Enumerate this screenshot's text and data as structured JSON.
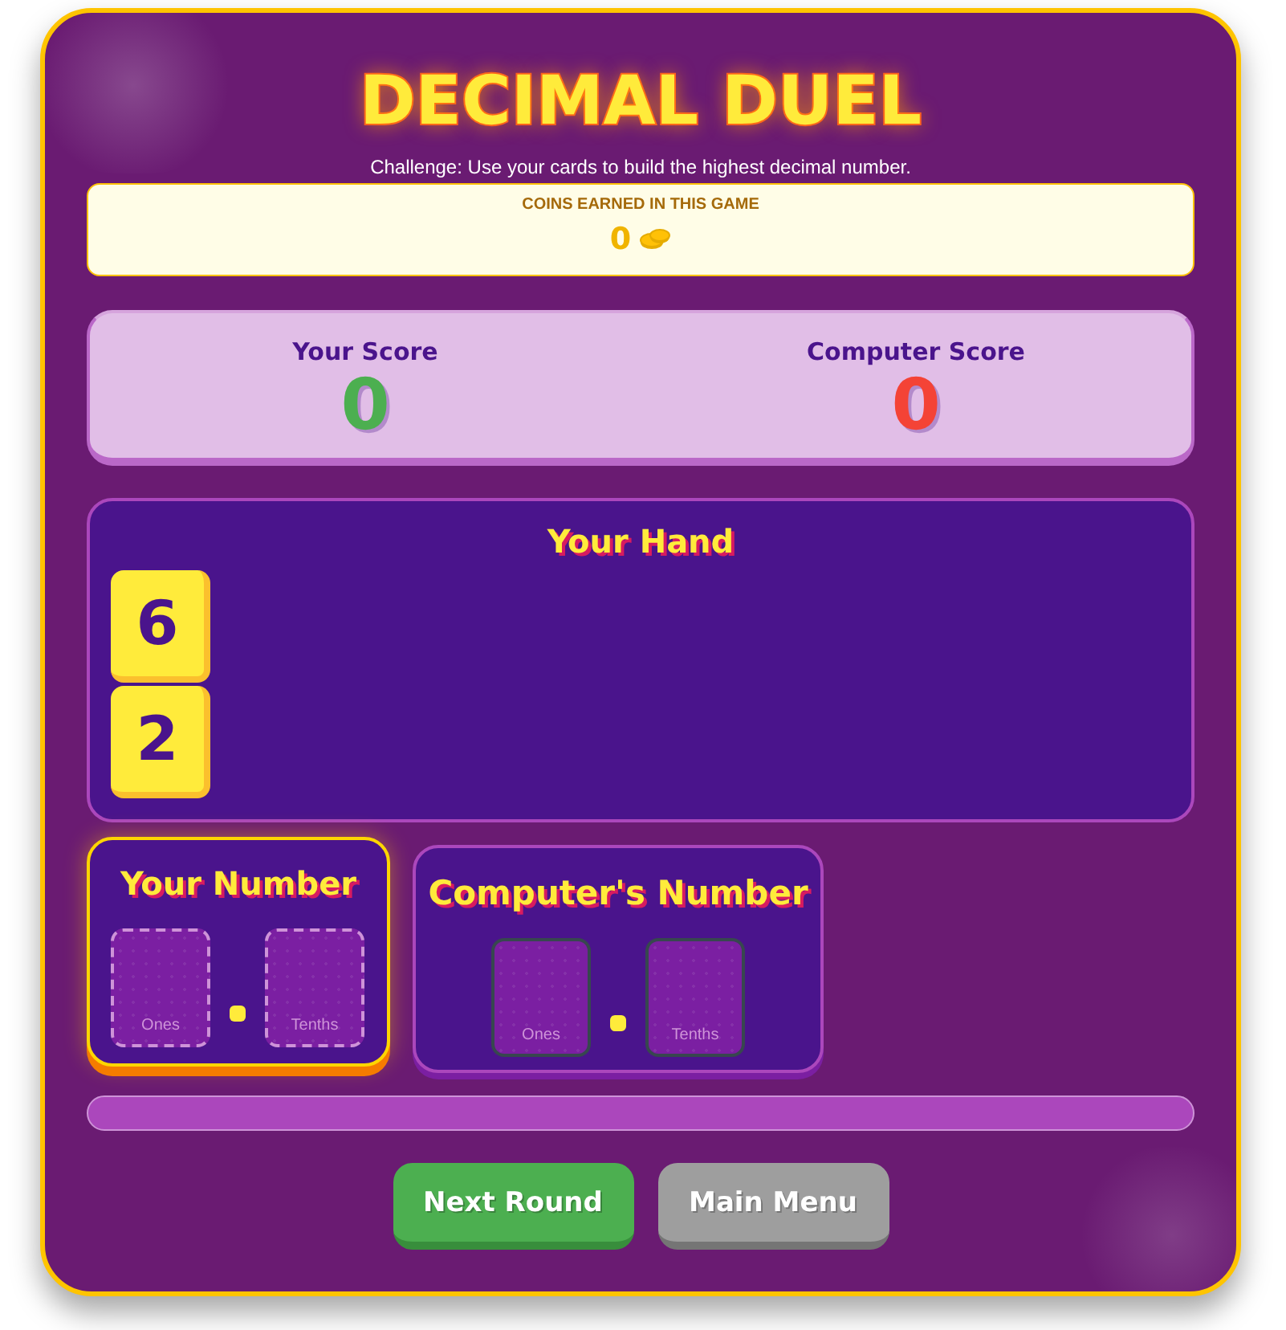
{
  "title": "DECIMAL DUEL",
  "challenge": "Challenge: Use your cards to build the highest decimal number.",
  "coins": {
    "label": "COINS EARNED IN THIS GAME",
    "value": "0"
  },
  "scores": [
    {
      "label": "Your Score",
      "value": "0",
      "color": "#4caf50"
    },
    {
      "label": "Computer Score",
      "value": "0",
      "color": "#f44336"
    }
  ],
  "hand": {
    "title": "Your Hand",
    "cards": [
      "6",
      "2"
    ]
  },
  "numbers": [
    {
      "kind": "player",
      "title": "Your Number",
      "slots": [
        "Ones",
        "Tenths"
      ]
    },
    {
      "kind": "computer",
      "title": "Computer's Number",
      "slots": [
        "Ones",
        "Tenths"
      ]
    }
  ],
  "buttons": [
    {
      "kind": "primary",
      "label": "Next Round"
    },
    {
      "kind": "secondary",
      "label": "Main Menu"
    }
  ]
}
